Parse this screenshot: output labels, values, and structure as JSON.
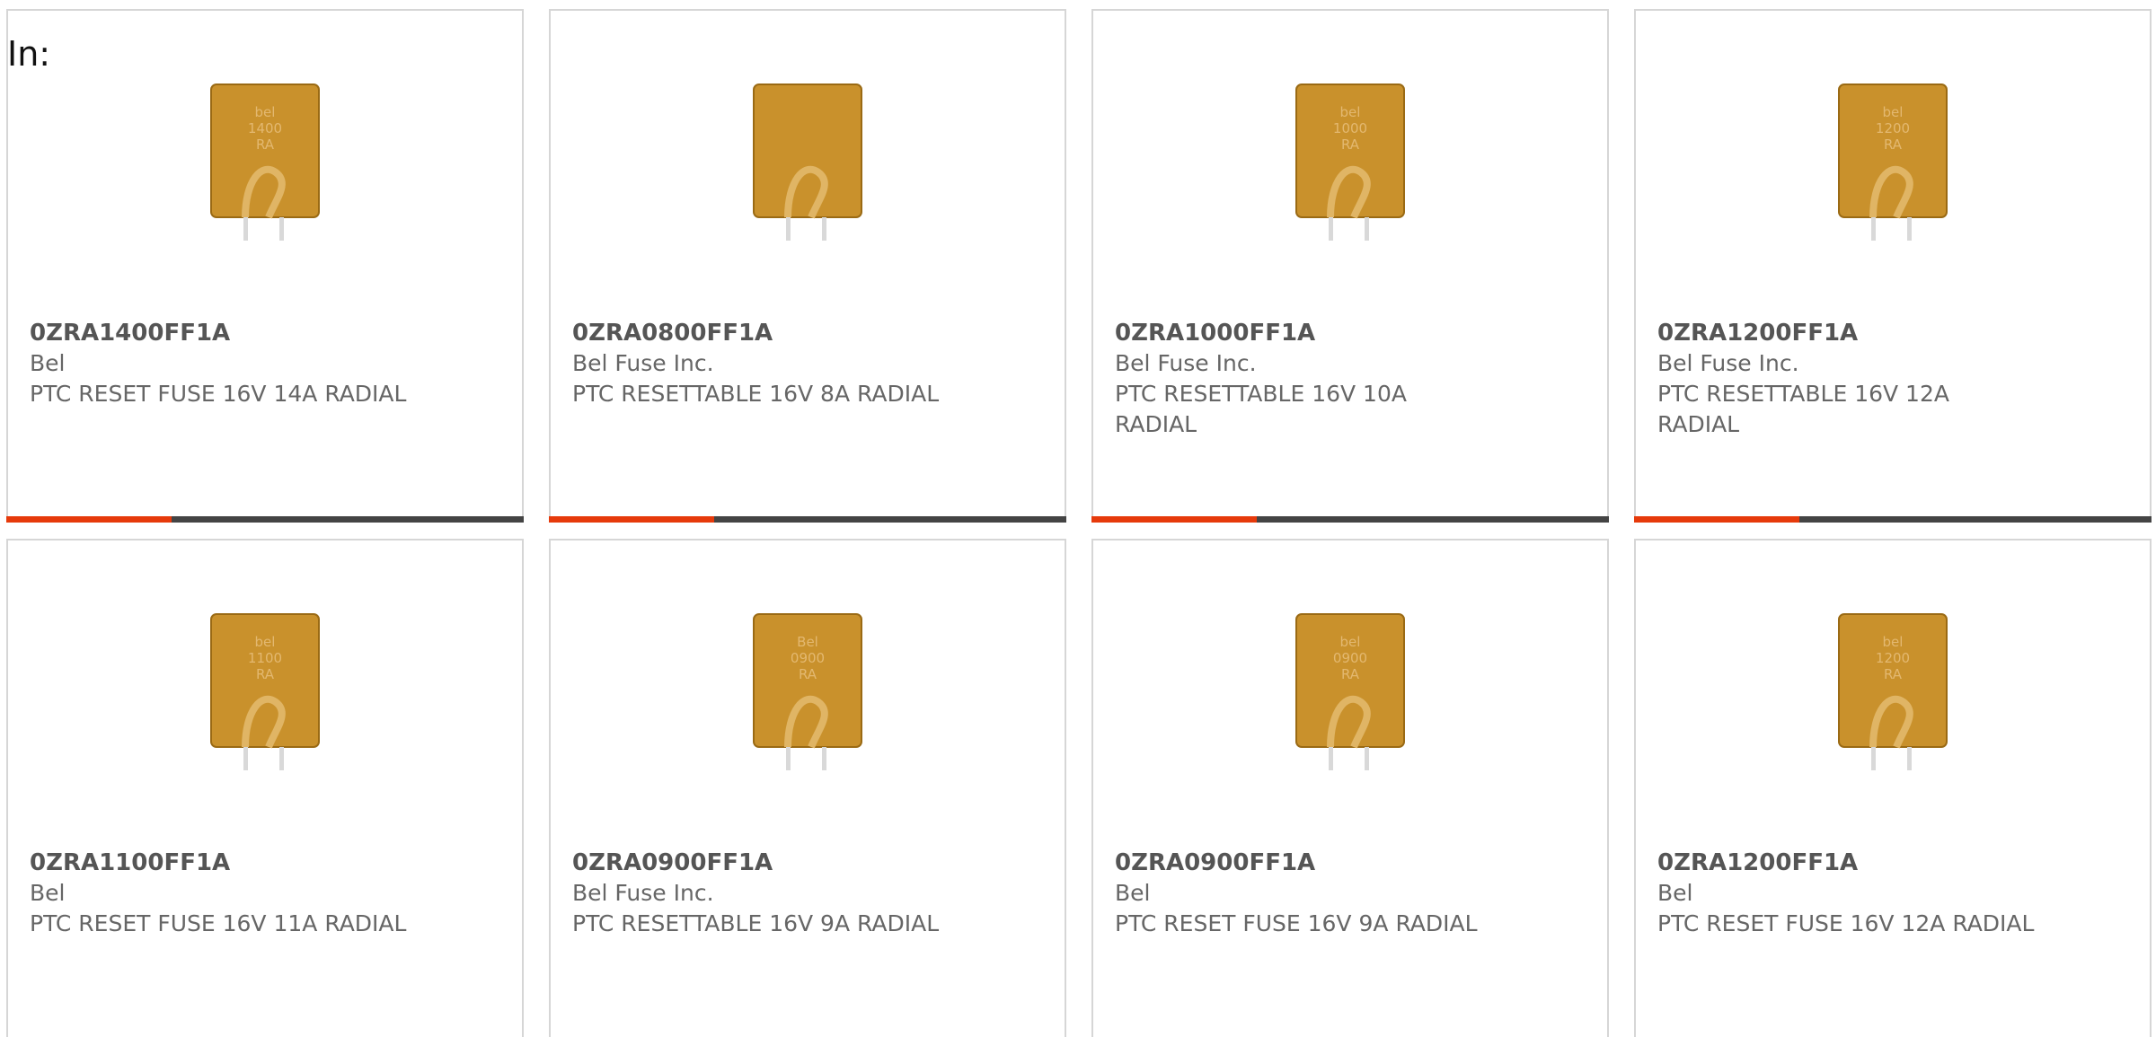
{
  "header": {
    "in_label": "In:"
  },
  "accent_color": "#e63a0b",
  "bar_color": "#444444",
  "products": [
    {
      "part": "0ZRA1400FF1A",
      "maker": "Bel",
      "desc": "PTC RESET FUSE 16V 14A RADIAL",
      "marking": [
        "bel",
        "1400",
        "RA"
      ],
      "icon": "ptc-fuse-image",
      "progress": 0.32
    },
    {
      "part": "0ZRA0800FF1A",
      "maker": "Bel Fuse Inc.",
      "desc": "PTC RESETTABLE 16V 8A RADIAL",
      "marking": [
        "",
        "",
        ""
      ],
      "icon": "ptc-fuse-image",
      "progress": 0.32
    },
    {
      "part": "0ZRA1000FF1A",
      "maker": "Bel Fuse Inc.",
      "desc": "PTC RESETTABLE 16V 10A RADIAL",
      "marking": [
        "bel",
        "1000",
        "RA"
      ],
      "icon": "ptc-fuse-image",
      "progress": 0.32
    },
    {
      "part": "0ZRA1200FF1A",
      "maker": "Bel Fuse Inc.",
      "desc": "PTC RESETTABLE 16V 12A RADIAL",
      "marking": [
        "bel",
        "1200",
        "RA"
      ],
      "icon": "ptc-fuse-image",
      "progress": 0.32
    },
    {
      "part": "0ZRA1100FF1A",
      "maker": "Bel",
      "desc": "PTC RESET FUSE 16V 11A RADIAL",
      "marking": [
        "bel",
        "1100",
        "RA"
      ],
      "icon": "ptc-fuse-image",
      "progress": null
    },
    {
      "part": "0ZRA0900FF1A",
      "maker": "Bel Fuse Inc.",
      "desc": "PTC RESETTABLE 16V 9A RADIAL",
      "marking": [
        "Bel",
        "0900",
        "RA"
      ],
      "icon": "ptc-fuse-image",
      "progress": null
    },
    {
      "part": "0ZRA0900FF1A",
      "maker": "Bel",
      "desc": "PTC RESET FUSE 16V 9A RADIAL",
      "marking": [
        "bel",
        "0900",
        "RA"
      ],
      "icon": "ptc-fuse-image",
      "progress": null
    },
    {
      "part": "0ZRA1200FF1A",
      "maker": "Bel",
      "desc": "PTC RESET FUSE 16V 12A RADIAL",
      "marking": [
        "bel",
        "1200",
        "RA"
      ],
      "icon": "ptc-fuse-image",
      "progress": null
    }
  ]
}
